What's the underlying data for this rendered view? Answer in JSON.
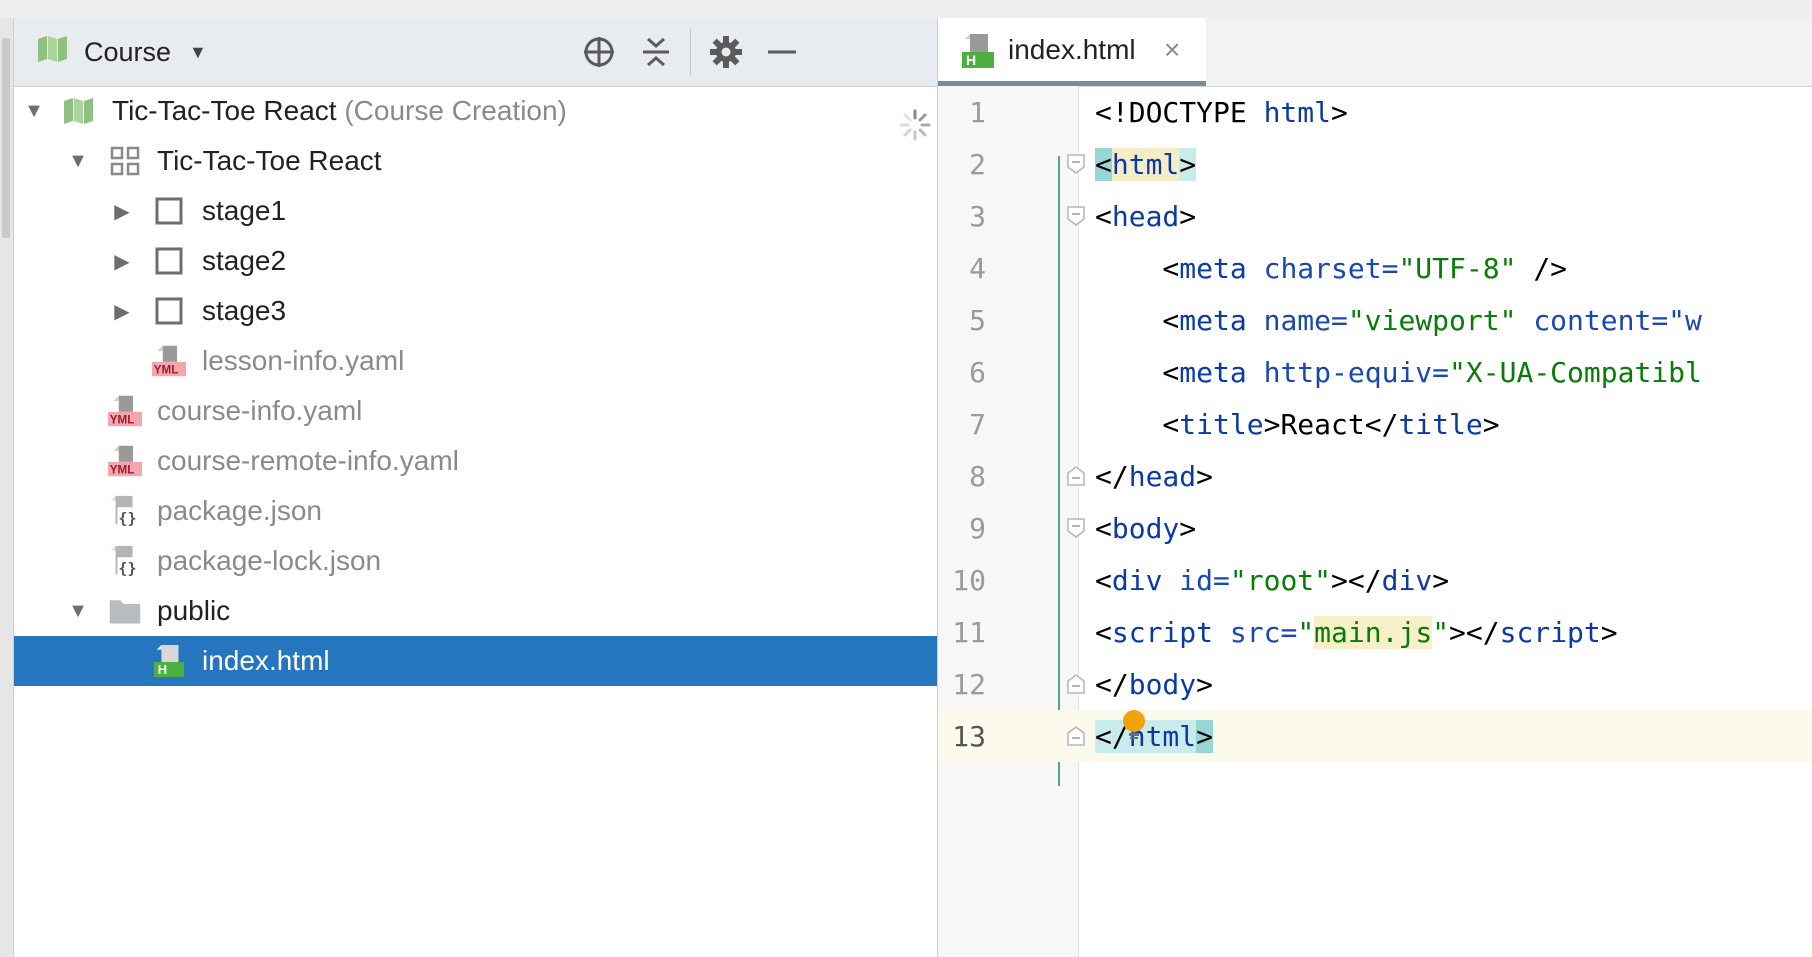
{
  "project_panel": {
    "title": "Course",
    "tree": [
      {
        "label": "Tic-Tac-Toe React",
        "suffix": "(Course Creation)"
      },
      {
        "label": "Tic-Tac-Toe React"
      },
      {
        "label": "stage1"
      },
      {
        "label": "stage2"
      },
      {
        "label": "stage3"
      },
      {
        "label": "lesson-info.yaml"
      },
      {
        "label": "course-info.yaml"
      },
      {
        "label": "course-remote-info.yaml"
      },
      {
        "label": "package.json"
      },
      {
        "label": "package-lock.json"
      },
      {
        "label": "public"
      },
      {
        "label": "index.html"
      }
    ]
  },
  "editor": {
    "tab": {
      "label": "index.html",
      "close": "×"
    },
    "line_numbers": [
      "1",
      "2",
      "3",
      "4",
      "5",
      "6",
      "7",
      "8",
      "9",
      "10",
      "11",
      "12",
      "13"
    ],
    "lines": [
      {
        "a": "<!DOCTYPE ",
        "b": "html",
        "c": ">"
      },
      {
        "a": "<",
        "b": "html",
        "c": ">"
      },
      {
        "a": "<",
        "b": "head",
        "c": ">"
      },
      {
        "a": "    <",
        "b": "meta ",
        "c": "charset=",
        "d": "\"UTF-8\"",
        "e": " />"
      },
      {
        "a": "    <",
        "b": "meta ",
        "c": "name=",
        "d": "\"viewport\"",
        "e": " content=\"w"
      },
      {
        "a": "    <",
        "b": "meta ",
        "c": "http-equiv=",
        "d": "\"X-UA-Compatibl"
      },
      {
        "a": "    <",
        "b": "title",
        "c": ">React</",
        "d": "title",
        "e": ">"
      },
      {
        "a": "</",
        "b": "head",
        "c": ">"
      },
      {
        "a": "<",
        "b": "body",
        "c": ">"
      },
      {
        "a": "<",
        "b": "div ",
        "c": "id=",
        "d": "\"root\"",
        "e": "></",
        "f": "div",
        "g": ">"
      },
      {
        "a": "<",
        "b": "script ",
        "c": "src=",
        "d": "\"",
        "e": "main.js",
        "f": "\"",
        "g": "></",
        "h": "script",
        "i": ">"
      },
      {
        "a": "</",
        "b": "body",
        "c": ">"
      },
      {
        "a": "</",
        "b": "html",
        "c": ">"
      }
    ]
  }
}
